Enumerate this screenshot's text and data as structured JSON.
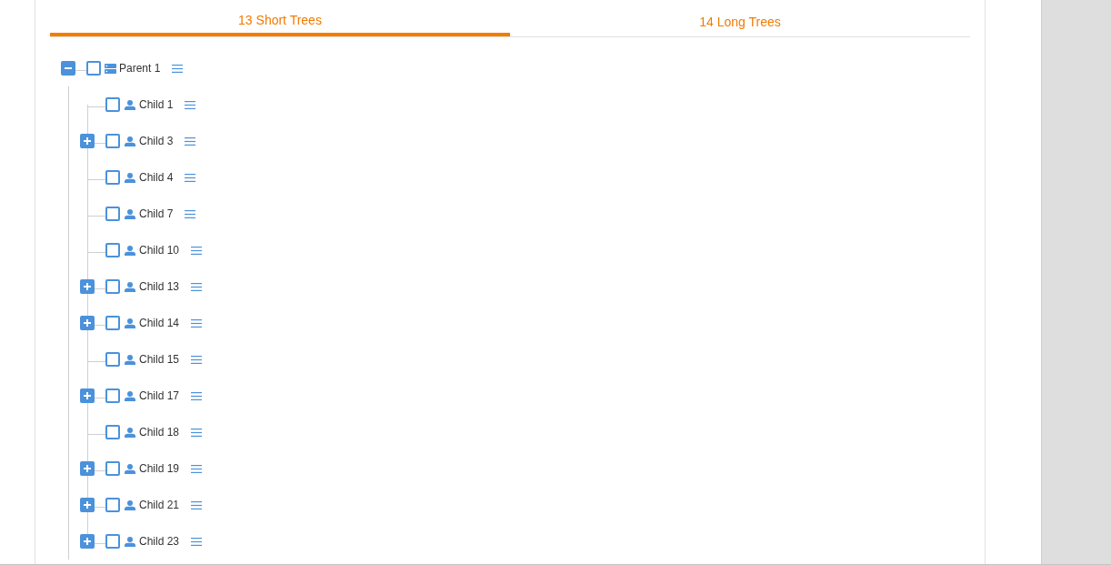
{
  "tabs": [
    {
      "label": "13 Short Trees",
      "selected": true
    },
    {
      "label": "14 Long Trees",
      "selected": false
    }
  ],
  "tree": [
    {
      "label": "Parent 1",
      "kind": "group",
      "expanded": true,
      "checked": false,
      "children": [
        {
          "label": "Child 1",
          "kind": "person",
          "checked": false
        },
        {
          "label": "Child 3",
          "kind": "person",
          "expanded": false,
          "checked": false
        },
        {
          "label": "Child 4",
          "kind": "person",
          "checked": false
        },
        {
          "label": "Child 7",
          "kind": "person",
          "checked": false
        },
        {
          "label": "Child 10",
          "kind": "person",
          "checked": false
        },
        {
          "label": "Child 13",
          "kind": "person",
          "expanded": false,
          "checked": false
        },
        {
          "label": "Child 14",
          "kind": "person",
          "expanded": false,
          "checked": false
        },
        {
          "label": "Child 15",
          "kind": "person",
          "checked": false
        },
        {
          "label": "Child 17",
          "kind": "person",
          "expanded": false,
          "checked": false
        },
        {
          "label": "Child 18",
          "kind": "person",
          "checked": false
        },
        {
          "label": "Child 19",
          "kind": "person",
          "expanded": false,
          "checked": false
        },
        {
          "label": "Child 21",
          "kind": "person",
          "expanded": false,
          "checked": false
        },
        {
          "label": "Child 23",
          "kind": "person",
          "expanded": false,
          "checked": false
        }
      ]
    }
  ]
}
